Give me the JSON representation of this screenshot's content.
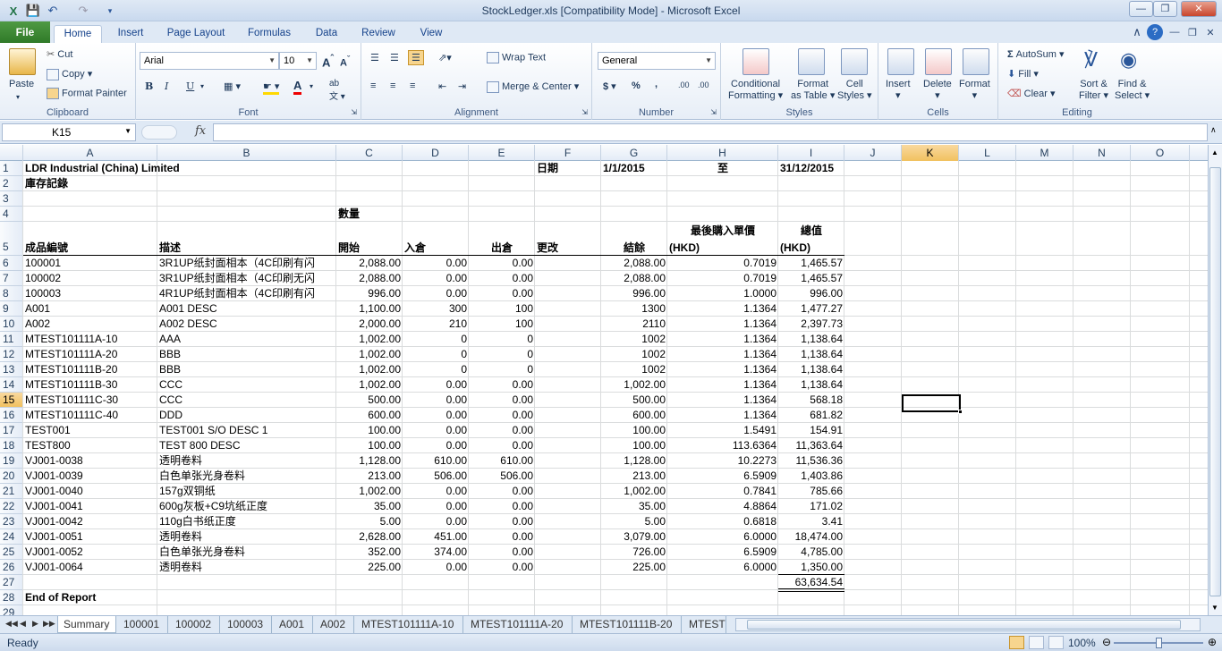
{
  "window": {
    "title": "StockLedger.xls  [Compatibility Mode]  -  Microsoft Excel"
  },
  "tabs": {
    "file": "File",
    "home": "Home",
    "insert": "Insert",
    "page_layout": "Page Layout",
    "formulas": "Formulas",
    "data": "Data",
    "review": "Review",
    "view": "View"
  },
  "ribbon": {
    "clipboard": {
      "label": "Clipboard",
      "paste": "Paste",
      "cut": "Cut",
      "copy": "Copy",
      "format_painter": "Format Painter"
    },
    "font": {
      "label": "Font",
      "name": "Arial",
      "size": "10"
    },
    "alignment": {
      "label": "Alignment",
      "wrap_text": "Wrap Text",
      "merge_center": "Merge & Center"
    },
    "number": {
      "label": "Number",
      "format": "General"
    },
    "styles": {
      "label": "Styles",
      "conditional": "Conditional",
      "formatting": "Formatting",
      "format": "Format",
      "as_table": "as Table",
      "cell": "Cell",
      "styles": "Styles"
    },
    "cells": {
      "label": "Cells",
      "insert": "Insert",
      "delete": "Delete",
      "format": "Format"
    },
    "editing": {
      "label": "Editing",
      "autosum": "AutoSum",
      "fill": "Fill",
      "clear": "Clear",
      "sort": "Sort &",
      "filter": "Filter",
      "find": "Find &",
      "select": "Select"
    }
  },
  "formula_bar": {
    "name_box": "K15",
    "fx": "fx",
    "formula": ""
  },
  "columns": [
    "A",
    "B",
    "C",
    "D",
    "E",
    "F",
    "G",
    "H",
    "I",
    "J",
    "K",
    "L",
    "M",
    "N",
    "O"
  ],
  "selected": {
    "column": "K",
    "row": "15"
  },
  "sheet": {
    "company": "LDR Industrial (China) Limited",
    "report_title": "庫存記錄",
    "date_label": "日期",
    "date_from": "1/1/2015",
    "to_label": "至",
    "date_to": "31/12/2015",
    "qty_header": "數量",
    "price_header": "最後購入單價",
    "total_header": "總值",
    "headers": {
      "code": "成品編號",
      "desc": "描述",
      "open": "開始",
      "in": "入倉",
      "out": "出倉",
      "adj": "更改",
      "bal": "結餘",
      "hkd1": "(HKD)",
      "hkd2": "(HKD)"
    },
    "rows": [
      [
        "100001",
        "3R1UP纸封面相本（4C印刷有闪",
        "2,088.00",
        "0.00",
        "0.00",
        "",
        "2,088.00",
        "0.7019",
        "1,465.57"
      ],
      [
        "100002",
        "3R1UP纸封面相本（4C印刷无闪",
        "2,088.00",
        "0.00",
        "0.00",
        "",
        "2,088.00",
        "0.7019",
        "1,465.57"
      ],
      [
        "100003",
        "4R1UP纸封面相本（4C印刷有闪",
        "996.00",
        "0.00",
        "0.00",
        "",
        "996.00",
        "1.0000",
        "996.00"
      ],
      [
        "A001",
        "A001 DESC",
        "1,100.00",
        "300",
        "100",
        "",
        "1300",
        "1.1364",
        "1,477.27"
      ],
      [
        "A002",
        "A002 DESC",
        "2,000.00",
        "210",
        "100",
        "",
        "2110",
        "1.1364",
        "2,397.73"
      ],
      [
        "MTEST101111A-10",
        "AAA",
        "1,002.00",
        "0",
        "0",
        "",
        "1002",
        "1.1364",
        "1,138.64"
      ],
      [
        "MTEST101111A-20",
        "BBB",
        "1,002.00",
        "0",
        "0",
        "",
        "1002",
        "1.1364",
        "1,138.64"
      ],
      [
        "MTEST101111B-20",
        "BBB",
        "1,002.00",
        "0",
        "0",
        "",
        "1002",
        "1.1364",
        "1,138.64"
      ],
      [
        "MTEST101111B-30",
        "CCC",
        "1,002.00",
        "0.00",
        "0.00",
        "",
        "1,002.00",
        "1.1364",
        "1,138.64"
      ],
      [
        "MTEST101111C-30",
        "CCC",
        "500.00",
        "0.00",
        "0.00",
        "",
        "500.00",
        "1.1364",
        "568.18"
      ],
      [
        "MTEST101111C-40",
        "DDD",
        "600.00",
        "0.00",
        "0.00",
        "",
        "600.00",
        "1.1364",
        "681.82"
      ],
      [
        "TEST001",
        "TEST001 S/O DESC 1",
        "100.00",
        "0.00",
        "0.00",
        "",
        "100.00",
        "1.5491",
        "154.91"
      ],
      [
        "TEST800",
        "TEST 800 DESC",
        "100.00",
        "0.00",
        "0.00",
        "",
        "100.00",
        "113.6364",
        "11,363.64"
      ],
      [
        "VJ001-0038",
        "透明卷料",
        "1,128.00",
        "610.00",
        "610.00",
        "",
        "1,128.00",
        "10.2273",
        "11,536.36"
      ],
      [
        "VJ001-0039",
        "白色单张光身卷料",
        "213.00",
        "506.00",
        "506.00",
        "",
        "213.00",
        "6.5909",
        "1,403.86"
      ],
      [
        "VJ001-0040",
        "157g双铜纸",
        "1,002.00",
        "0.00",
        "0.00",
        "",
        "1,002.00",
        "0.7841",
        "785.66"
      ],
      [
        "VJ001-0041",
        "600g灰板+C9坑纸正度",
        "35.00",
        "0.00",
        "0.00",
        "",
        "35.00",
        "4.8864",
        "171.02"
      ],
      [
        "VJ001-0042",
        "110g白书纸正度",
        "5.00",
        "0.00",
        "0.00",
        "",
        "5.00",
        "0.6818",
        "3.41"
      ],
      [
        "VJ001-0051",
        "透明卷料",
        "2,628.00",
        "451.00",
        "0.00",
        "",
        "3,079.00",
        "6.0000",
        "18,474.00"
      ],
      [
        "VJ001-0052",
        "白色单张光身卷料",
        "352.00",
        "374.00",
        "0.00",
        "",
        "726.00",
        "6.5909",
        "4,785.00"
      ],
      [
        "VJ001-0064",
        "透明卷料",
        "225.00",
        "0.00",
        "0.00",
        "",
        "225.00",
        "6.0000",
        "1,350.00"
      ]
    ],
    "grand_total": "63,634.54",
    "end_label": "End of Report"
  },
  "row_numbers": [
    "1",
    "2",
    "3",
    "4",
    "5",
    "6",
    "7",
    "8",
    "9",
    "10",
    "11",
    "12",
    "13",
    "14",
    "15",
    "16",
    "17",
    "18",
    "19",
    "20",
    "21",
    "22",
    "23",
    "24",
    "25",
    "26",
    "27",
    "28",
    "29"
  ],
  "sheet_tabs": [
    "Summary",
    "100001",
    "100002",
    "100003",
    "A001",
    "A002",
    "MTEST101111A-10",
    "MTEST101111A-20",
    "MTEST101111B-20",
    "MTEST"
  ],
  "status": {
    "ready": "Ready",
    "zoom": "100%"
  }
}
